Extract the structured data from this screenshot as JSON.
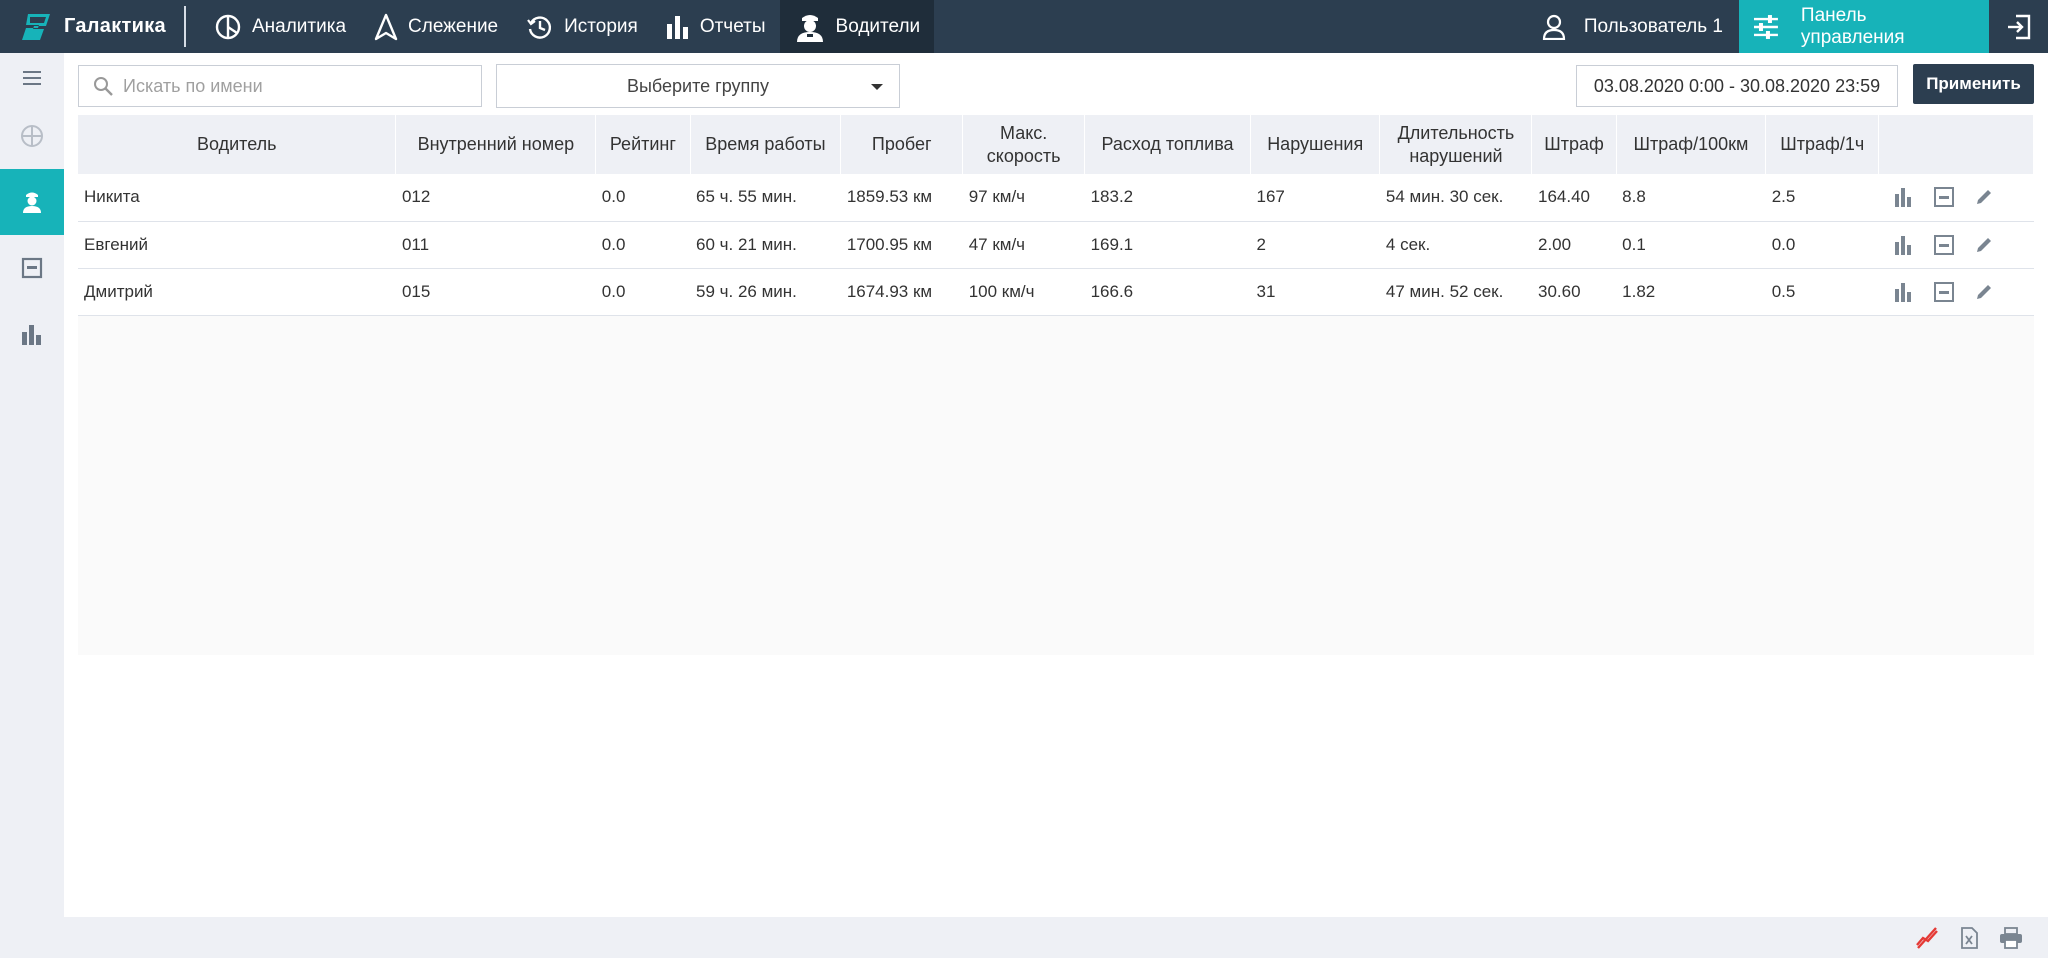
{
  "app": {
    "name": "Галактика"
  },
  "nav": [
    {
      "label": "Аналитика",
      "icon": "analytics-icon"
    },
    {
      "label": "Слежение",
      "icon": "tracking-icon"
    },
    {
      "label": "История",
      "icon": "history-icon"
    },
    {
      "label": "Отчеты",
      "icon": "reports-icon"
    },
    {
      "label": "Водители",
      "icon": "drivers-icon",
      "active": true
    }
  ],
  "user": {
    "label": "Пользователь 1"
  },
  "control_panel": {
    "label": "Панель управления"
  },
  "toolbar": {
    "search_placeholder": "Искать по имени",
    "group_select": "Выберите группу",
    "date_range": "03.08.2020 0:00 - 30.08.2020 23:59",
    "apply_label": "Применить"
  },
  "table": {
    "headers": [
      "Водитель",
      "Внутренний номер",
      "Рейтинг",
      "Время работы",
      "Пробег",
      "Макс. скорость",
      "Расход топлива",
      "Нарушения",
      "Длительность нарушений",
      "Штраф",
      "Штраф/100км",
      "Штраф/1ч",
      ""
    ],
    "rows": [
      [
        "Никита",
        "012",
        "0.0",
        "65 ч. 55 мин.",
        "1859.53 км",
        "97 км/ч",
        "183.2",
        "167",
        "54 мин. 30 сек.",
        "164.40",
        "8.8",
        "2.5"
      ],
      [
        "Евгений",
        "011",
        "0.0",
        "60 ч. 21 мин.",
        "1700.95 км",
        "47 км/ч",
        "169.1",
        "2",
        "4 сек.",
        "2.00",
        "0.1",
        "0.0"
      ],
      [
        "Дмитрий",
        "015",
        "0.0",
        "59 ч. 26 мин.",
        "1674.93 км",
        "100 км/ч",
        "166.6",
        "31",
        "47 мин. 52 сек.",
        "30.60",
        "1.82",
        "0.5"
      ]
    ]
  },
  "colors": {
    "topbar": "#2c3e50",
    "accent": "#17b3b9",
    "no_data_red": "#e53935"
  }
}
